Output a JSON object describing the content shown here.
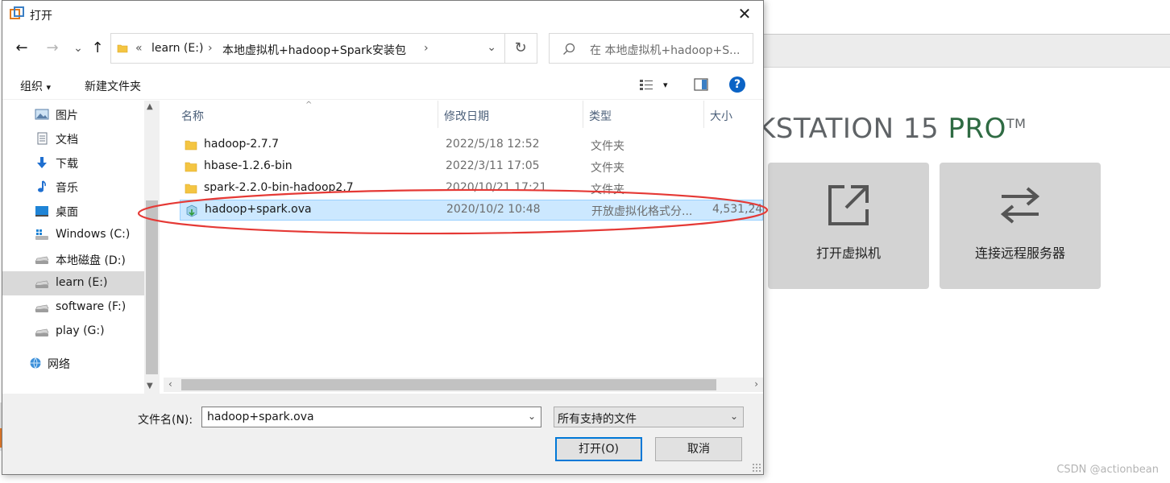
{
  "background": {
    "heading": "KSTATION 15",
    "heading_suffix": "PRO",
    "tm": "TM",
    "cards": [
      {
        "label": "打开虚拟机",
        "icon": "open-external-icon"
      },
      {
        "label": "连接远程服务器",
        "icon": "swap-arrows-icon"
      }
    ],
    "watermark": "CSDN @actionbean"
  },
  "dialog": {
    "title": "打开",
    "close": "✕",
    "nav": {
      "back": "←",
      "forward": "→",
      "recent": "⌄",
      "up": "↑",
      "breadcrumb_overflow": "«",
      "path": [
        "learn (E:)",
        "本地虚拟机+hadoop+Spark安装包"
      ],
      "separator": "›",
      "refresh": "↻",
      "search_placeholder": "在 本地虚拟机+hadoop+S..."
    },
    "toolbar": {
      "organize": "组织",
      "organize_caret": "▾",
      "new_folder": "新建文件夹",
      "view_caret": "▾",
      "help": "?"
    },
    "sidebar": {
      "items": [
        {
          "label": "图片",
          "icon": "pictures-icon"
        },
        {
          "label": "文档",
          "icon": "documents-icon"
        },
        {
          "label": "下载",
          "icon": "downloads-icon"
        },
        {
          "label": "音乐",
          "icon": "music-icon"
        },
        {
          "label": "桌面",
          "icon": "desktop-icon"
        },
        {
          "label": "Windows (C:)",
          "icon": "windows-drive-icon"
        },
        {
          "label": "本地磁盘 (D:)",
          "icon": "drive-icon"
        },
        {
          "label": "learn (E:)",
          "icon": "drive-icon",
          "selected": true
        },
        {
          "label": "software (F:)",
          "icon": "drive-icon"
        },
        {
          "label": "play (G:)",
          "icon": "drive-icon"
        },
        {
          "label": "网络",
          "icon": "network-icon"
        }
      ]
    },
    "columns": {
      "name": "名称",
      "date": "修改日期",
      "type": "类型",
      "size": "大小",
      "sort_caret": "^"
    },
    "files": [
      {
        "name": "hadoop-2.7.7",
        "date": "2022/5/18 12:52",
        "type": "文件夹",
        "size": "",
        "icon": "folder-icon"
      },
      {
        "name": "hbase-1.2.6-bin",
        "date": "2022/3/11 17:05",
        "type": "文件夹",
        "size": "",
        "icon": "folder-icon"
      },
      {
        "name": "spark-2.2.0-bin-hadoop2.7",
        "date": "2020/10/21 17:21",
        "type": "文件夹",
        "size": "",
        "icon": "folder-icon"
      },
      {
        "name": "hadoop+spark.ova",
        "date": "2020/10/2 10:48",
        "type": "开放虚拟化格式分...",
        "size": "4,531,24",
        "icon": "ova-file-icon",
        "selected": true
      }
    ],
    "scroll": {
      "up": "▲",
      "down": "▼",
      "left": "‹",
      "right": "›"
    },
    "bottom": {
      "filename_label": "文件名(N):",
      "filename_value": "hadoop+spark.ova",
      "filetype_value": "所有支持的文件",
      "dropdown_caret": "⌄",
      "open_button": "打开(O)",
      "cancel_button": "取消"
    }
  },
  "colors": {
    "accent": "#0078d7",
    "selection": "#cce8ff",
    "annotation": "#e53935",
    "vmware_green": "#2f6b43"
  }
}
